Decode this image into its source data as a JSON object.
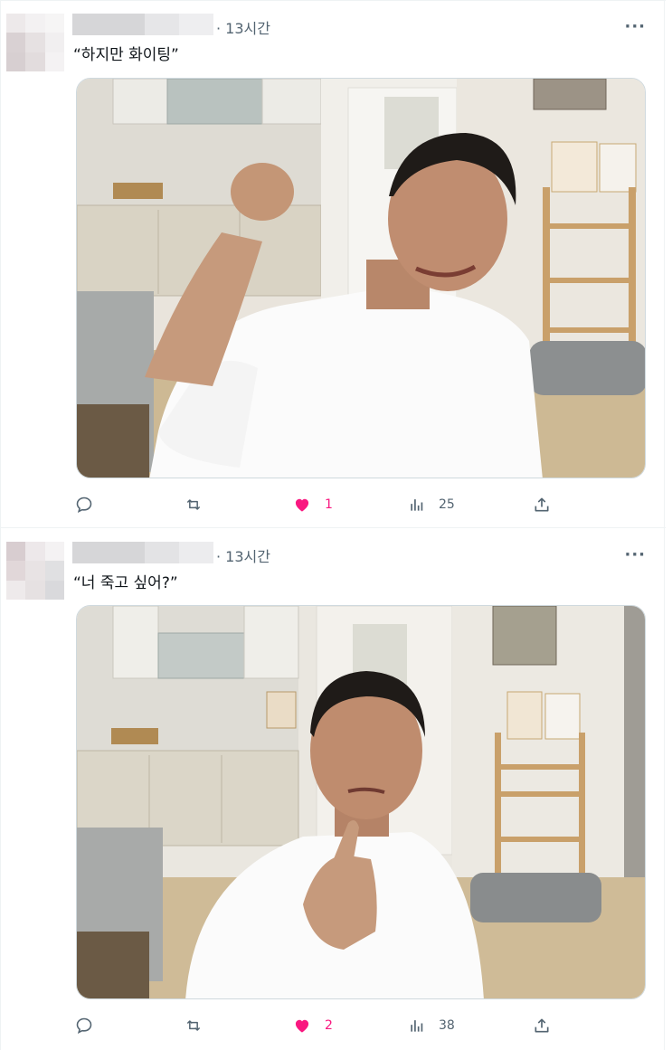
{
  "tweets": [
    {
      "time": "· 13시간",
      "more": "···",
      "text": "“하지만 화이팅”",
      "media_icon": "photo-man-raising-fist",
      "likes": "1",
      "views": "25",
      "liked": true
    },
    {
      "time": "· 13시간",
      "more": "···",
      "text": "“너 죽고 싶어?”",
      "media_icon": "photo-man-pointing-finger",
      "likes": "2",
      "views": "38",
      "liked": true
    }
  ],
  "colors": {
    "like_pink": "#f91880",
    "icon_gray": "#536471",
    "border": "#eff3f4"
  },
  "icons": [
    "reply-icon",
    "retweet-icon",
    "heart-filled-icon",
    "views-icon",
    "share-icon"
  ]
}
